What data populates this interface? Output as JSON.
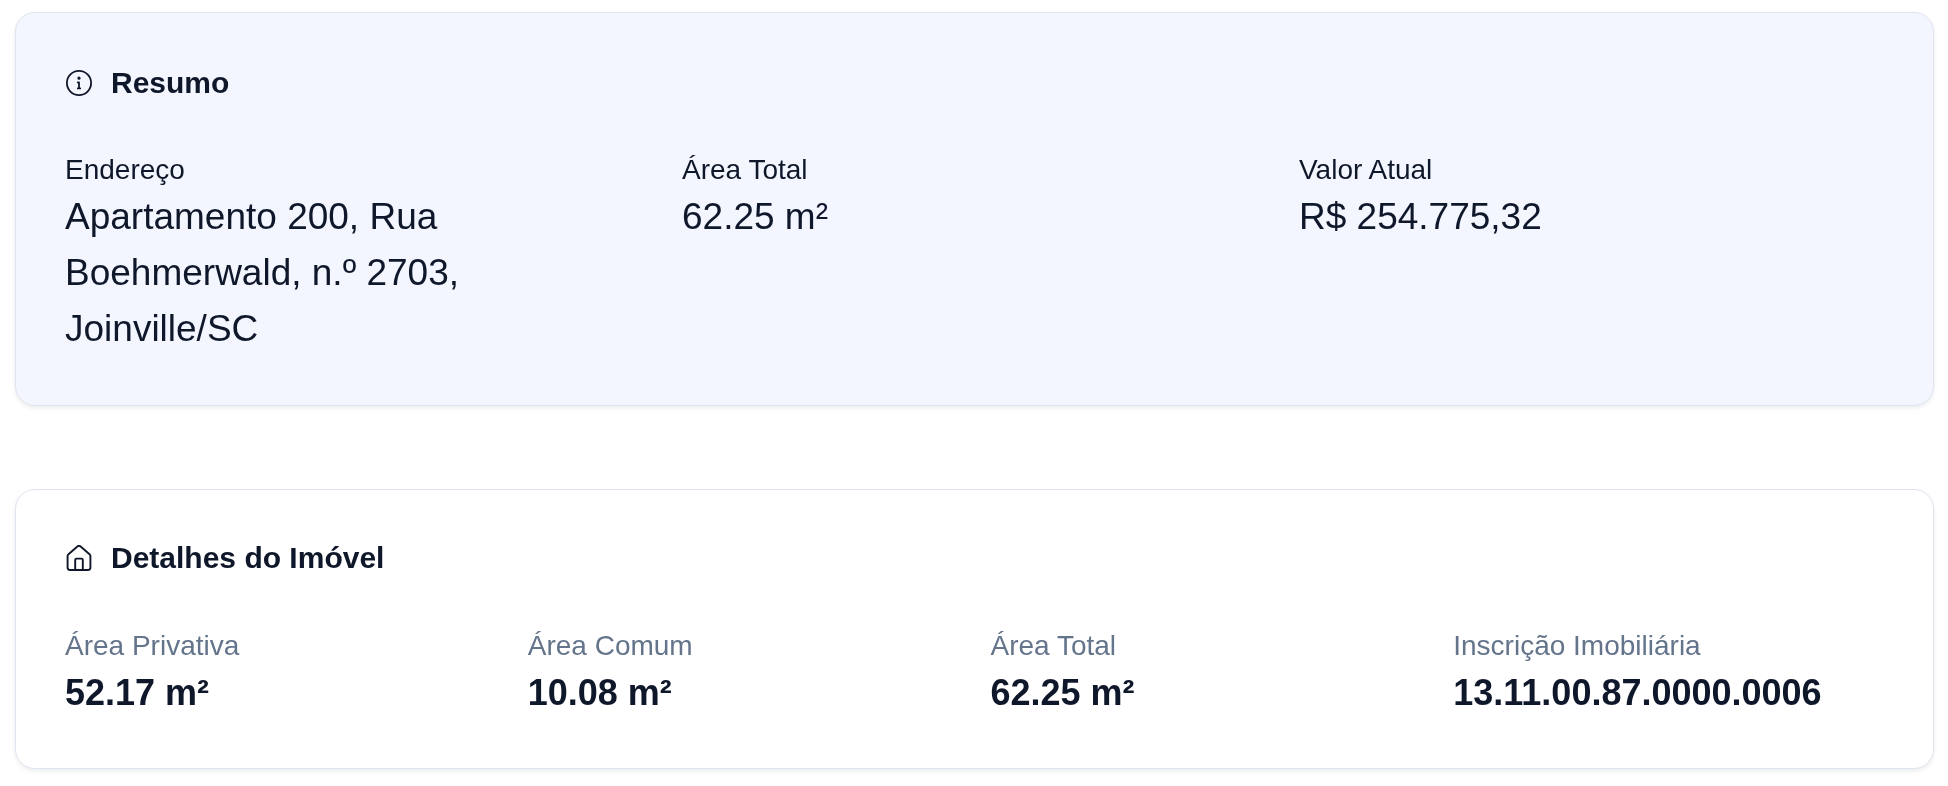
{
  "summary": {
    "title": "Resumo",
    "fields": [
      {
        "label": "Endereço",
        "value": "Apartamento 200, Rua Boehmerwald, n.º 2703, Joinville/SC"
      },
      {
        "label": "Área Total",
        "value": "62.25 m²"
      },
      {
        "label": "Valor Atual",
        "value": "R$ 254.775,32"
      }
    ]
  },
  "details": {
    "title": "Detalhes do Imóvel",
    "fields": [
      {
        "label": "Área Privativa",
        "value": "52.17 m²"
      },
      {
        "label": "Área Comum",
        "value": "10.08 m²"
      },
      {
        "label": "Área Total",
        "value": "62.25 m²"
      },
      {
        "label": "Inscrição Imobiliária",
        "value": "13.11.00.87.0000.0006"
      }
    ]
  }
}
